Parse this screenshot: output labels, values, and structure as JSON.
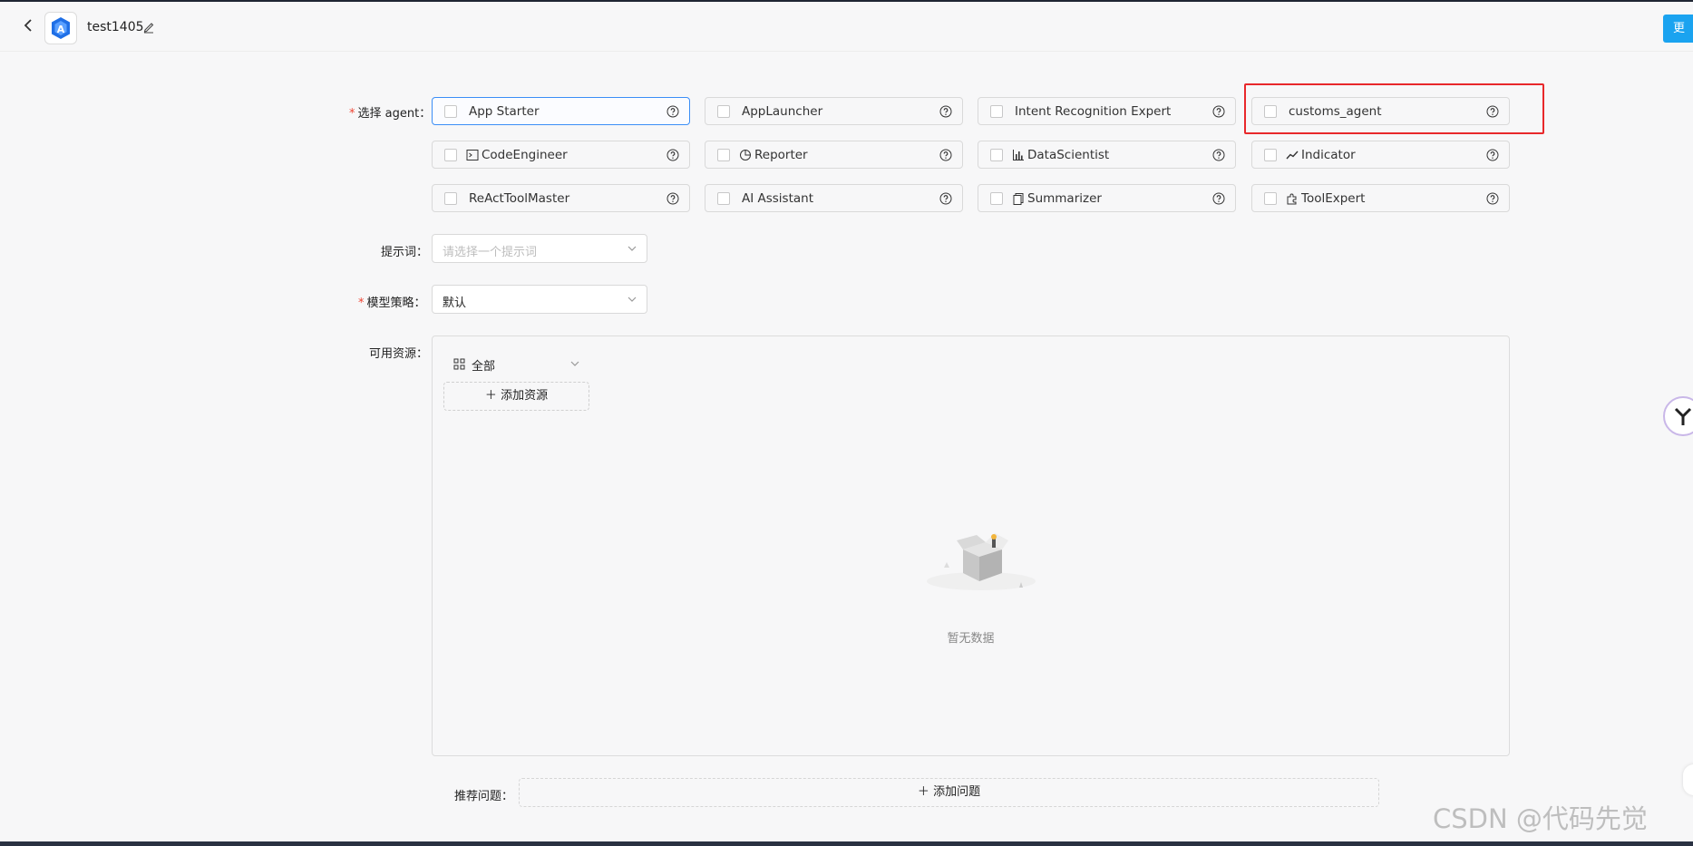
{
  "header": {
    "app_name": "test1405",
    "update_label": "更"
  },
  "form": {
    "agent_label": "选择 agent",
    "prompt_label": "提示词",
    "model_label": "模型策略",
    "resources_label": "可用资源",
    "questions_label": "推荐问题"
  },
  "agents": [
    {
      "label": "App Starter",
      "icon": "",
      "checked": false
    },
    {
      "label": "AppLauncher",
      "icon": "",
      "checked": false
    },
    {
      "label": "Intent Recognition Expert",
      "icon": "",
      "checked": false
    },
    {
      "label": "customs_agent",
      "icon": "",
      "checked": false
    },
    {
      "label": "CodeEngineer",
      "icon": "terminal-icon",
      "checked": false
    },
    {
      "label": "Reporter",
      "icon": "pie-chart-icon",
      "checked": false
    },
    {
      "label": "DataScientist",
      "icon": "bar-chart-icon",
      "checked": false
    },
    {
      "label": "Indicator",
      "icon": "line-chart-icon",
      "checked": false
    },
    {
      "label": "ReActToolMaster",
      "icon": "",
      "checked": false
    },
    {
      "label": "AI Assistant",
      "icon": "",
      "checked": false
    },
    {
      "label": "Summarizer",
      "icon": "copy-icon",
      "checked": false
    },
    {
      "label": "ToolExpert",
      "icon": "puzzle-icon",
      "checked": false
    }
  ],
  "prompt_select": {
    "placeholder": "请选择一个提示词"
  },
  "model_select": {
    "value": "默认"
  },
  "resources": {
    "filter_value": "全部",
    "add_label": "添加资源",
    "empty_text": "暂无数据"
  },
  "questions": {
    "add_label": "添加问题"
  },
  "watermark": "CSDN @代码先觉",
  "colors": {
    "highlight": "#e8282b",
    "accent": "#1aa3f0",
    "active_border": "#3b8ef6",
    "required": "#e43"
  }
}
